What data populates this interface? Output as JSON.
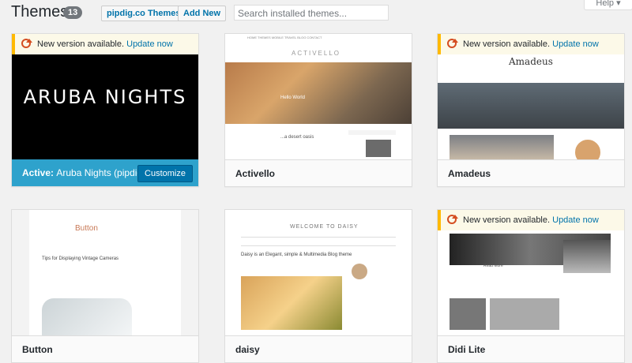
{
  "header": {
    "title": "Themes",
    "count": "13",
    "buttons": [
      "pipdig.co Themes",
      "Add New"
    ],
    "search_placeholder": "Search installed themes...",
    "help_label": "Help ▾"
  },
  "themes": [
    {
      "name": "Aruba Nights",
      "active": true,
      "active_label": "Active:",
      "active_name": "Aruba Nights (pipdig)",
      "customize_label": "Customize",
      "update_notice": "New version available.",
      "update_link": "Update now",
      "preview_text": "ARUBA NIGHTS"
    },
    {
      "name": "Activello",
      "active": false,
      "preview_nav": "HOME  THEMES  MOBILE  TRAVEL  BLOG  CONTACT",
      "preview_logo": "ACTIVELLO",
      "preview_heading": "...a desert oasis",
      "preview_hero_caption": "Hello World"
    },
    {
      "name": "Amadeus",
      "active": false,
      "update_notice": "New version available.",
      "update_link": "Update now",
      "preview_logo": "Amadeus"
    },
    {
      "name": "Button",
      "active": false,
      "preview_title": "Button",
      "preview_heading": "Tips for Displaying Vintage Cameras"
    },
    {
      "name": "daisy",
      "active": false,
      "preview_logo": "WELCOME TO DAISY",
      "preview_title": "Daisy is an Elegant, simple & Multimedia Blog theme"
    },
    {
      "name": "Didi Lite",
      "active": false,
      "update_notice": "New version available.",
      "update_link": "Update now",
      "preview_heading": "Read More"
    }
  ],
  "colors": {
    "accent": "#0073aa",
    "active_bar": "#2ea2cc",
    "notice_border": "#ffb900",
    "refresh_icon": "#d54e21"
  }
}
